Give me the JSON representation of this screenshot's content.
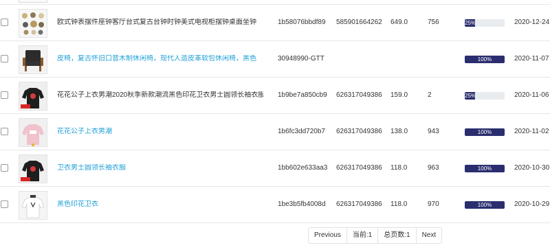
{
  "rows": [
    {
      "title": "欧式钟表摆件座钟客厅台式复古台钟时钟美式电视柜摆钟桌面坐钟",
      "sku": "1b58076bbdf89",
      "spu": "585901664262",
      "price": "649.0",
      "stock": "756",
      "progress_label": "25%",
      "progress": 0.25,
      "date": "2020-12-24",
      "image": "clock-set"
    },
    {
      "title": "皮椅，复古怀旧口音木制休闲椅，现代人造皮革软包休闲椅，黑色",
      "sku": "30948990-GTT",
      "spu": "",
      "price": "",
      "stock": "",
      "progress_label": "100%",
      "progress": 1.0,
      "date": "2020-11-07",
      "image": "leather-chair"
    },
    {
      "title": "花花公子上衣男潮2020秋季新款潮流黑色印花卫衣男士圆领长袖衣服",
      "sku": "1b9be7a850cb9",
      "spu": "626317049386",
      "price": "159.0",
      "stock": "2",
      "progress_label": "25%",
      "progress": 0.25,
      "date": "2020-11-06",
      "image": "black-sweatshirt"
    },
    {
      "title": "花花公子上衣男潮",
      "sku": "1b6fc3dd720b7",
      "spu": "626317049386",
      "price": "138.0",
      "stock": "943",
      "progress_label": "100%",
      "progress": 1.0,
      "date": "2020-11-02",
      "image": "pink-sweatshirt"
    },
    {
      "title": "卫衣男士圆领长袖衣服",
      "sku": "1bb602e633aa3",
      "spu": "626317049386",
      "price": "118.0",
      "stock": "963",
      "progress_label": "100%",
      "progress": 1.0,
      "date": "2020-10-30",
      "image": "black-sweatshirt"
    },
    {
      "title": "黑色印花卫衣",
      "sku": "1be3b5fb4008d",
      "spu": "626317049386",
      "price": "118.0",
      "stock": "970",
      "progress_label": "100%",
      "progress": 1.0,
      "date": "2020-10-29",
      "image": "white-sweatshirt"
    }
  ],
  "title_links": [
    false,
    true,
    false,
    true,
    true,
    true
  ],
  "pagination": {
    "previous": "Previous",
    "current": "当前:1",
    "total": "总页数:1",
    "next": "Next"
  },
  "colors": {
    "link": "#1f9fd6",
    "progress_fill": "#2a2e6e",
    "progress_track": "#e9ecef"
  }
}
